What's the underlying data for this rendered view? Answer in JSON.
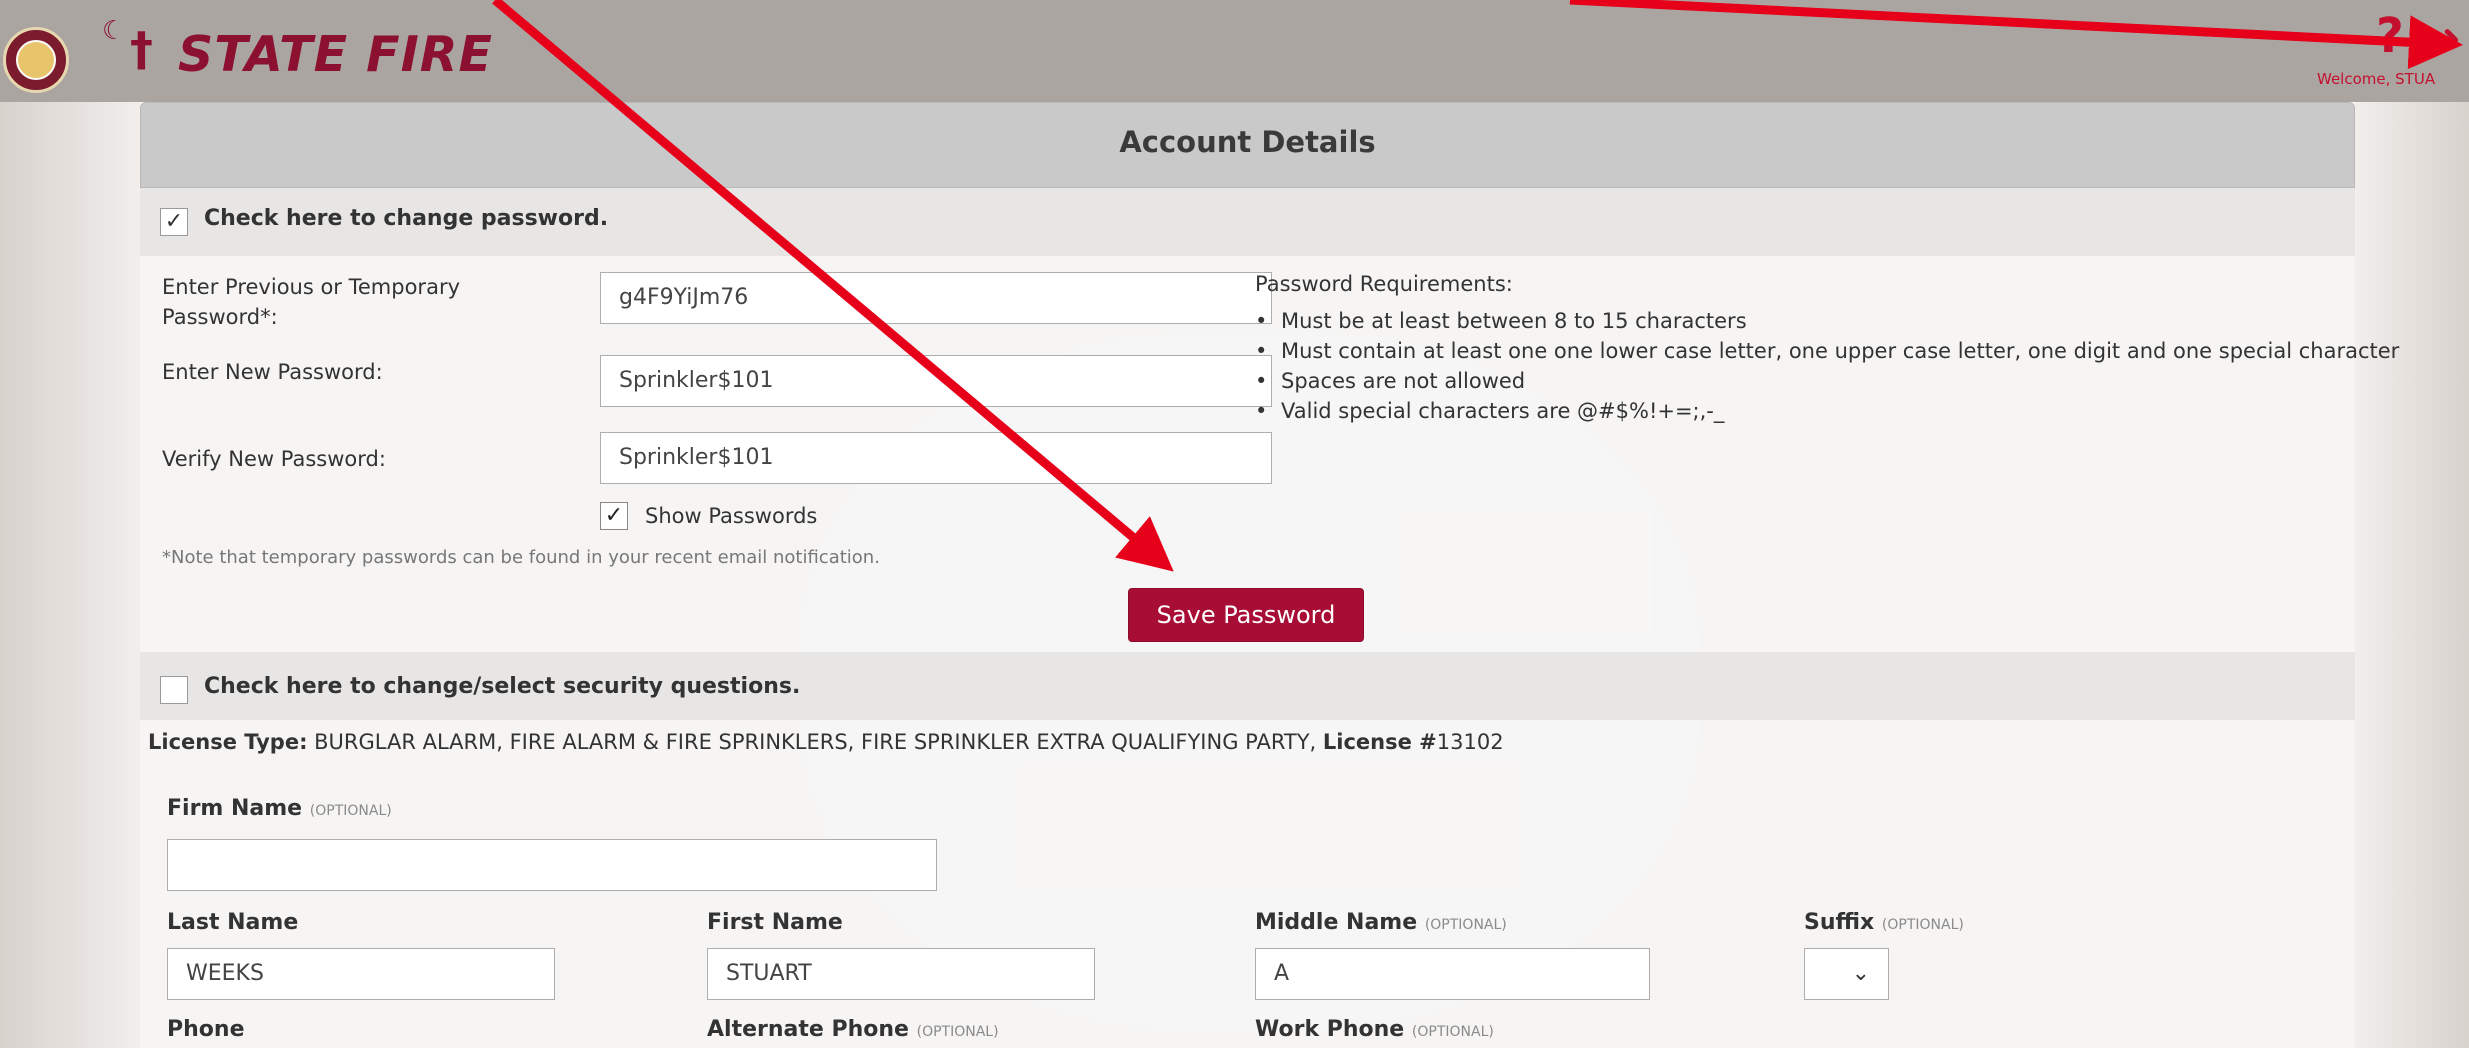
{
  "header": {
    "brand": "STATE FIRE",
    "welcome": "Welcome, STUA",
    "help_icon": "question-mark-icon",
    "logout_icon": "arrow-right-icon",
    "accent": "#8c1131"
  },
  "panel": {
    "title": "Account Details"
  },
  "password_section": {
    "checkbox_mark": "✓",
    "label": "Check here to change password.",
    "prev_label": "Enter Previous or Temporary Password*:",
    "prev_value": "g4F9YiJm76",
    "new_label": "Enter New Password:",
    "new_value": "Sprinkler$101",
    "verify_label": "Verify New Password:",
    "verify_value": "Sprinkler$101",
    "show_mark": "✓",
    "show_label": "Show Passwords",
    "note": "*Note that temporary passwords can be found in your recent email notification.",
    "save_button": "Save Password",
    "requirements_title": "Password Requirements:",
    "requirements": [
      "Must be at least between 8 to 15 characters",
      "Must contain at least one one lower case letter, one upper case letter, one digit and one special character",
      "Spaces are not allowed",
      "Valid special characters are @#$%!+=;,-_"
    ]
  },
  "security_section": {
    "label": "Check here to change/select security questions."
  },
  "license": {
    "type_label": "License Type:",
    "type_value": " BURGLAR ALARM, FIRE ALARM & FIRE SPRINKLERS, FIRE SPRINKLER EXTRA QUALIFYING PARTY, ",
    "number_label": "License #",
    "number_value": "13102"
  },
  "form": {
    "firm_label": "Firm Name",
    "optional": "(OPTIONAL)",
    "firm_value": "",
    "last_label": "Last Name",
    "last_value": "WEEKS",
    "first_label": "First Name",
    "first_value": "STUART",
    "middle_label": "Middle Name",
    "middle_value": "A",
    "suffix_label": "Suffix",
    "suffix_value": "",
    "suffix_chevron": "⌄",
    "phone_label": "Phone",
    "alt_phone_label": "Alternate Phone",
    "work_phone_label": "Work Phone"
  }
}
